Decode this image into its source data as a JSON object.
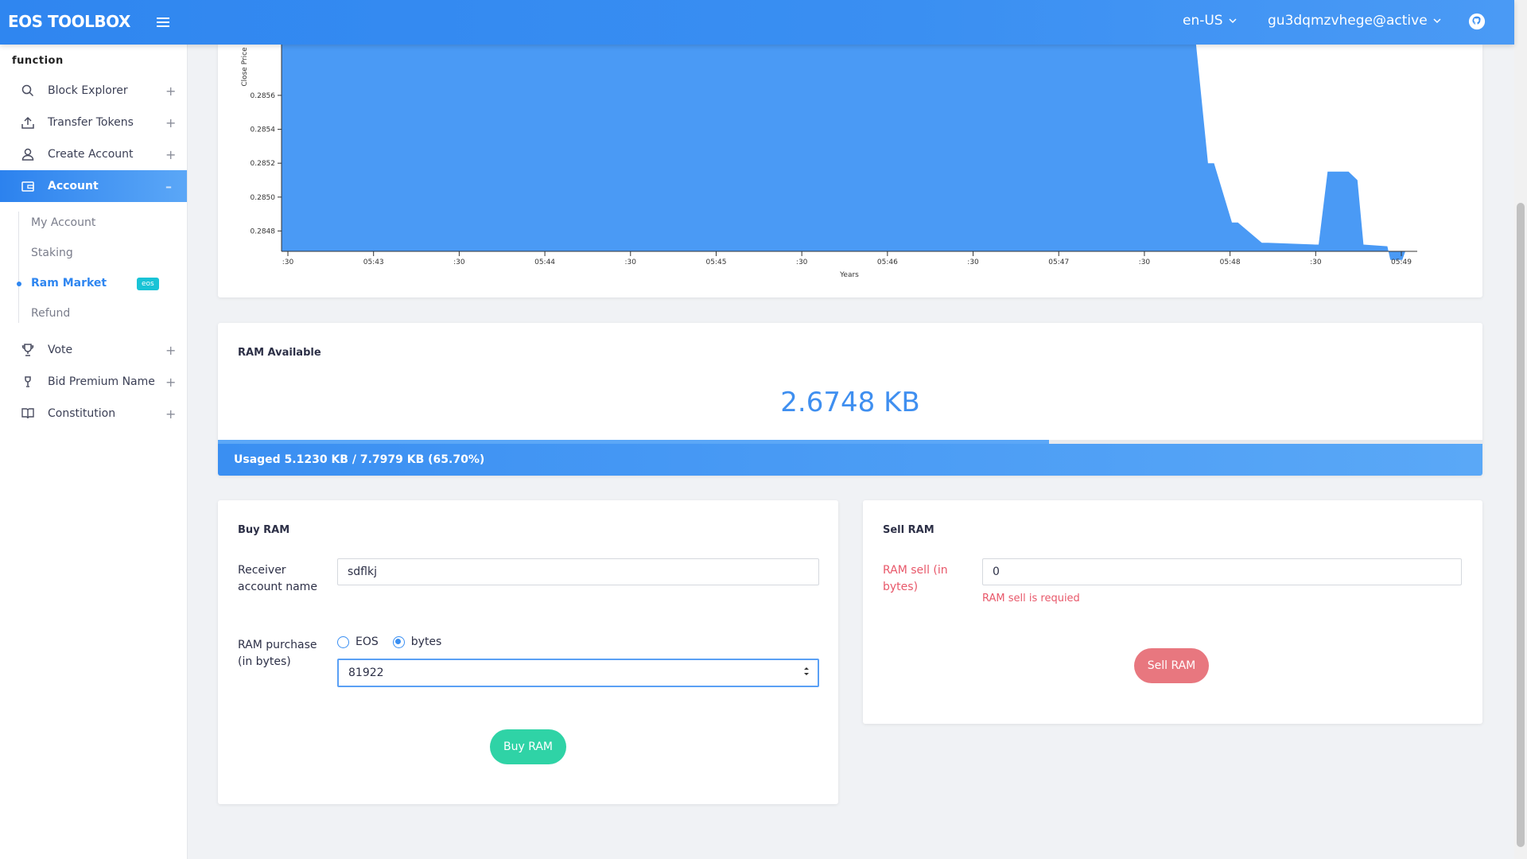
{
  "header": {
    "brand": "EOS TOOLBOX",
    "language": "en-US",
    "account": "gu3dqmzvhege@active"
  },
  "sidebar": {
    "section_title": "function",
    "items": [
      {
        "label": "Block Explorer",
        "icon": "search-icon",
        "expand": "+"
      },
      {
        "label": "Transfer Tokens",
        "icon": "upload-icon",
        "expand": "+"
      },
      {
        "label": "Create Account",
        "icon": "user-icon",
        "expand": "+"
      },
      {
        "label": "Account",
        "icon": "wallet-icon",
        "expand": "–"
      },
      {
        "label": "Vote",
        "icon": "trophy-icon",
        "expand": "+"
      },
      {
        "label": "Bid Premium Name",
        "icon": "gavel-icon",
        "expand": "+"
      },
      {
        "label": "Constitution",
        "icon": "book-icon",
        "expand": "+"
      }
    ],
    "account_sub": [
      {
        "label": "My Account"
      },
      {
        "label": "Staking"
      },
      {
        "label": "Ram Market",
        "badge": "eos"
      },
      {
        "label": "Refund"
      }
    ]
  },
  "chart_data": {
    "type": "area",
    "ylabel": "Close Price",
    "xlabel": "Years",
    "y_ticks": [
      "0.2856",
      "0.2854",
      "0.2852",
      "0.2850",
      "0.2848"
    ],
    "x_ticks": [
      ":30",
      "05:43",
      ":30",
      "05:44",
      ":30",
      "05:45",
      ":30",
      "05:46",
      ":30",
      "05:47",
      ":30",
      "05:48",
      ":30",
      "05:49"
    ],
    "ylim": [
      0.28468,
      0.2859
    ],
    "color": "#4a9af5",
    "x_minutes": [
      0,
      15.2,
      15.3,
      15.5,
      15.6,
      15.9,
      16.0,
      16.4,
      16.5,
      17.3,
      17.35,
      17.5,
      17.85,
      18.0,
      18.1,
      18.5,
      18.55,
      18.75,
      18.8,
      19.0
    ],
    "values": [
      0.2859,
      0.2859,
      0.2859,
      0.2852,
      0.2852,
      0.28485,
      0.28485,
      0.28473,
      0.28473,
      0.28472,
      0.28472,
      0.28515,
      0.28515,
      0.2851,
      0.28472,
      0.28471,
      0.28463,
      0.28463,
      0.28468,
      0.28468
    ]
  },
  "ram": {
    "title": "RAM Available",
    "available": "2.6748 KB",
    "usage_text": "Usaged 5.1230 KB / 7.7979 KB (65.70%)",
    "usage_fraction": 0.657
  },
  "buy": {
    "title": "Buy RAM",
    "receiver_label": "Receiver account name",
    "receiver_value": "sdflkj",
    "purchase_label": "RAM purchase (in bytes)",
    "unit_eos": "EOS",
    "unit_bytes": "bytes",
    "selected_unit": "bytes",
    "purchase_value": "81922",
    "button": "Buy RAM"
  },
  "sell": {
    "title": "Sell RAM",
    "amount_label": "RAM sell (in bytes)",
    "amount_value": "0",
    "error": "RAM sell is requied",
    "button": "Sell RAM"
  }
}
